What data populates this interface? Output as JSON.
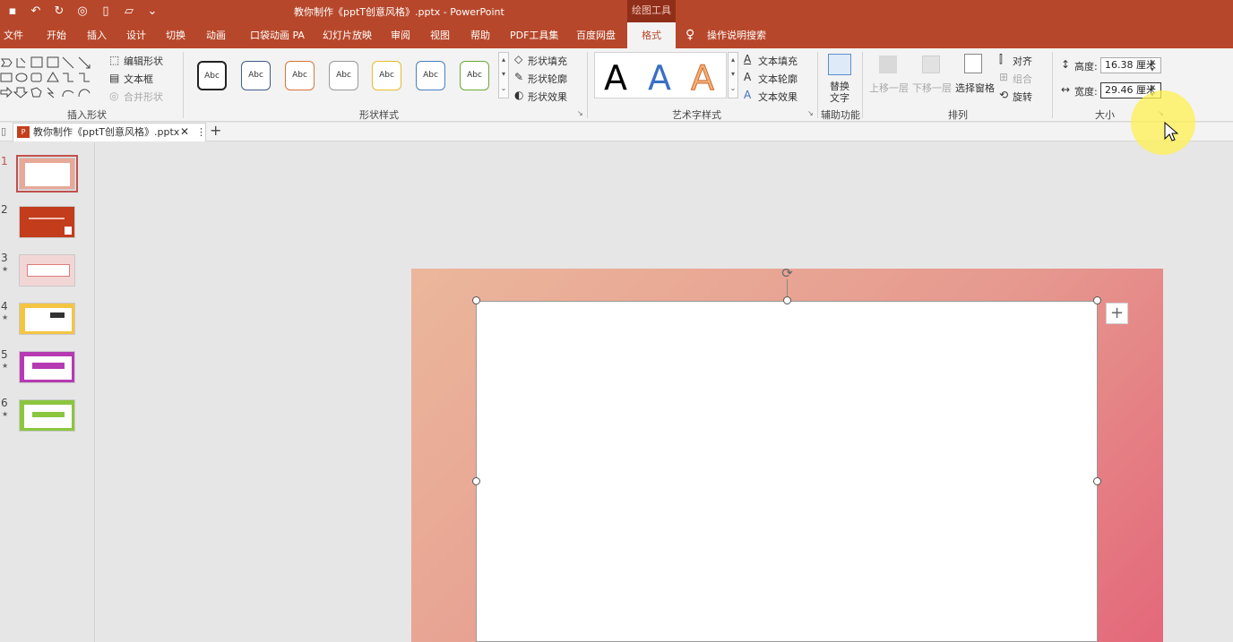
{
  "app": {
    "doc_title": "教你制作《pptT创意风格》.pptx  -  PowerPoint",
    "context_tab": "绘图工具"
  },
  "tabs": [
    {
      "label": "文件"
    },
    {
      "label": "开始"
    },
    {
      "label": "插入"
    },
    {
      "label": "设计"
    },
    {
      "label": "切换"
    },
    {
      "label": "动画"
    },
    {
      "label": "口袋动画 PA"
    },
    {
      "label": "幻灯片放映"
    },
    {
      "label": "审阅"
    },
    {
      "label": "视图"
    },
    {
      "label": "帮助"
    },
    {
      "label": "PDF工具集"
    },
    {
      "label": "百度网盘"
    },
    {
      "label": "格式"
    }
  ],
  "tell_me": "操作说明搜索",
  "ribbon": {
    "insert_shapes": {
      "label": "插入形状",
      "edit_shape": "编辑形状",
      "text_box": "文本框",
      "merge_shapes": "合并形状"
    },
    "shape_styles": {
      "label": "形状样式",
      "sample": "Abc",
      "fill": "形状填充",
      "outline": "形状轮廓",
      "effects": "形状效果"
    },
    "wordart": {
      "label": "艺术字样式",
      "letter": "A",
      "text_fill": "文本填充",
      "text_outline": "文本轮廓",
      "text_effects": "文本效果"
    },
    "accessibility": {
      "label": "辅助功能",
      "alt_text_line1": "替换",
      "alt_text_line2": "文字"
    },
    "arrange": {
      "label": "排列",
      "bring_forward": "上移一层",
      "send_backward": "下移一层",
      "selection_pane": "选择窗格",
      "align": "对齐",
      "group": "组合",
      "rotate": "旋转"
    },
    "size": {
      "label": "大小",
      "height_label": "高度:",
      "height_value": "16.38 厘米",
      "width_label": "宽度:",
      "width_value": "29.46 厘米"
    }
  },
  "doc_tab": {
    "label": "教你制作《pptT创意风格》.pptx"
  },
  "slides": [
    {
      "number": "1",
      "star": ""
    },
    {
      "number": "2",
      "star": ""
    },
    {
      "number": "3",
      "star": "★"
    },
    {
      "number": "4",
      "star": "★"
    },
    {
      "number": "5",
      "star": "★"
    },
    {
      "number": "6",
      "star": "★"
    }
  ],
  "colors": {
    "accent": "#b7472a",
    "selection": "#c0504d"
  }
}
